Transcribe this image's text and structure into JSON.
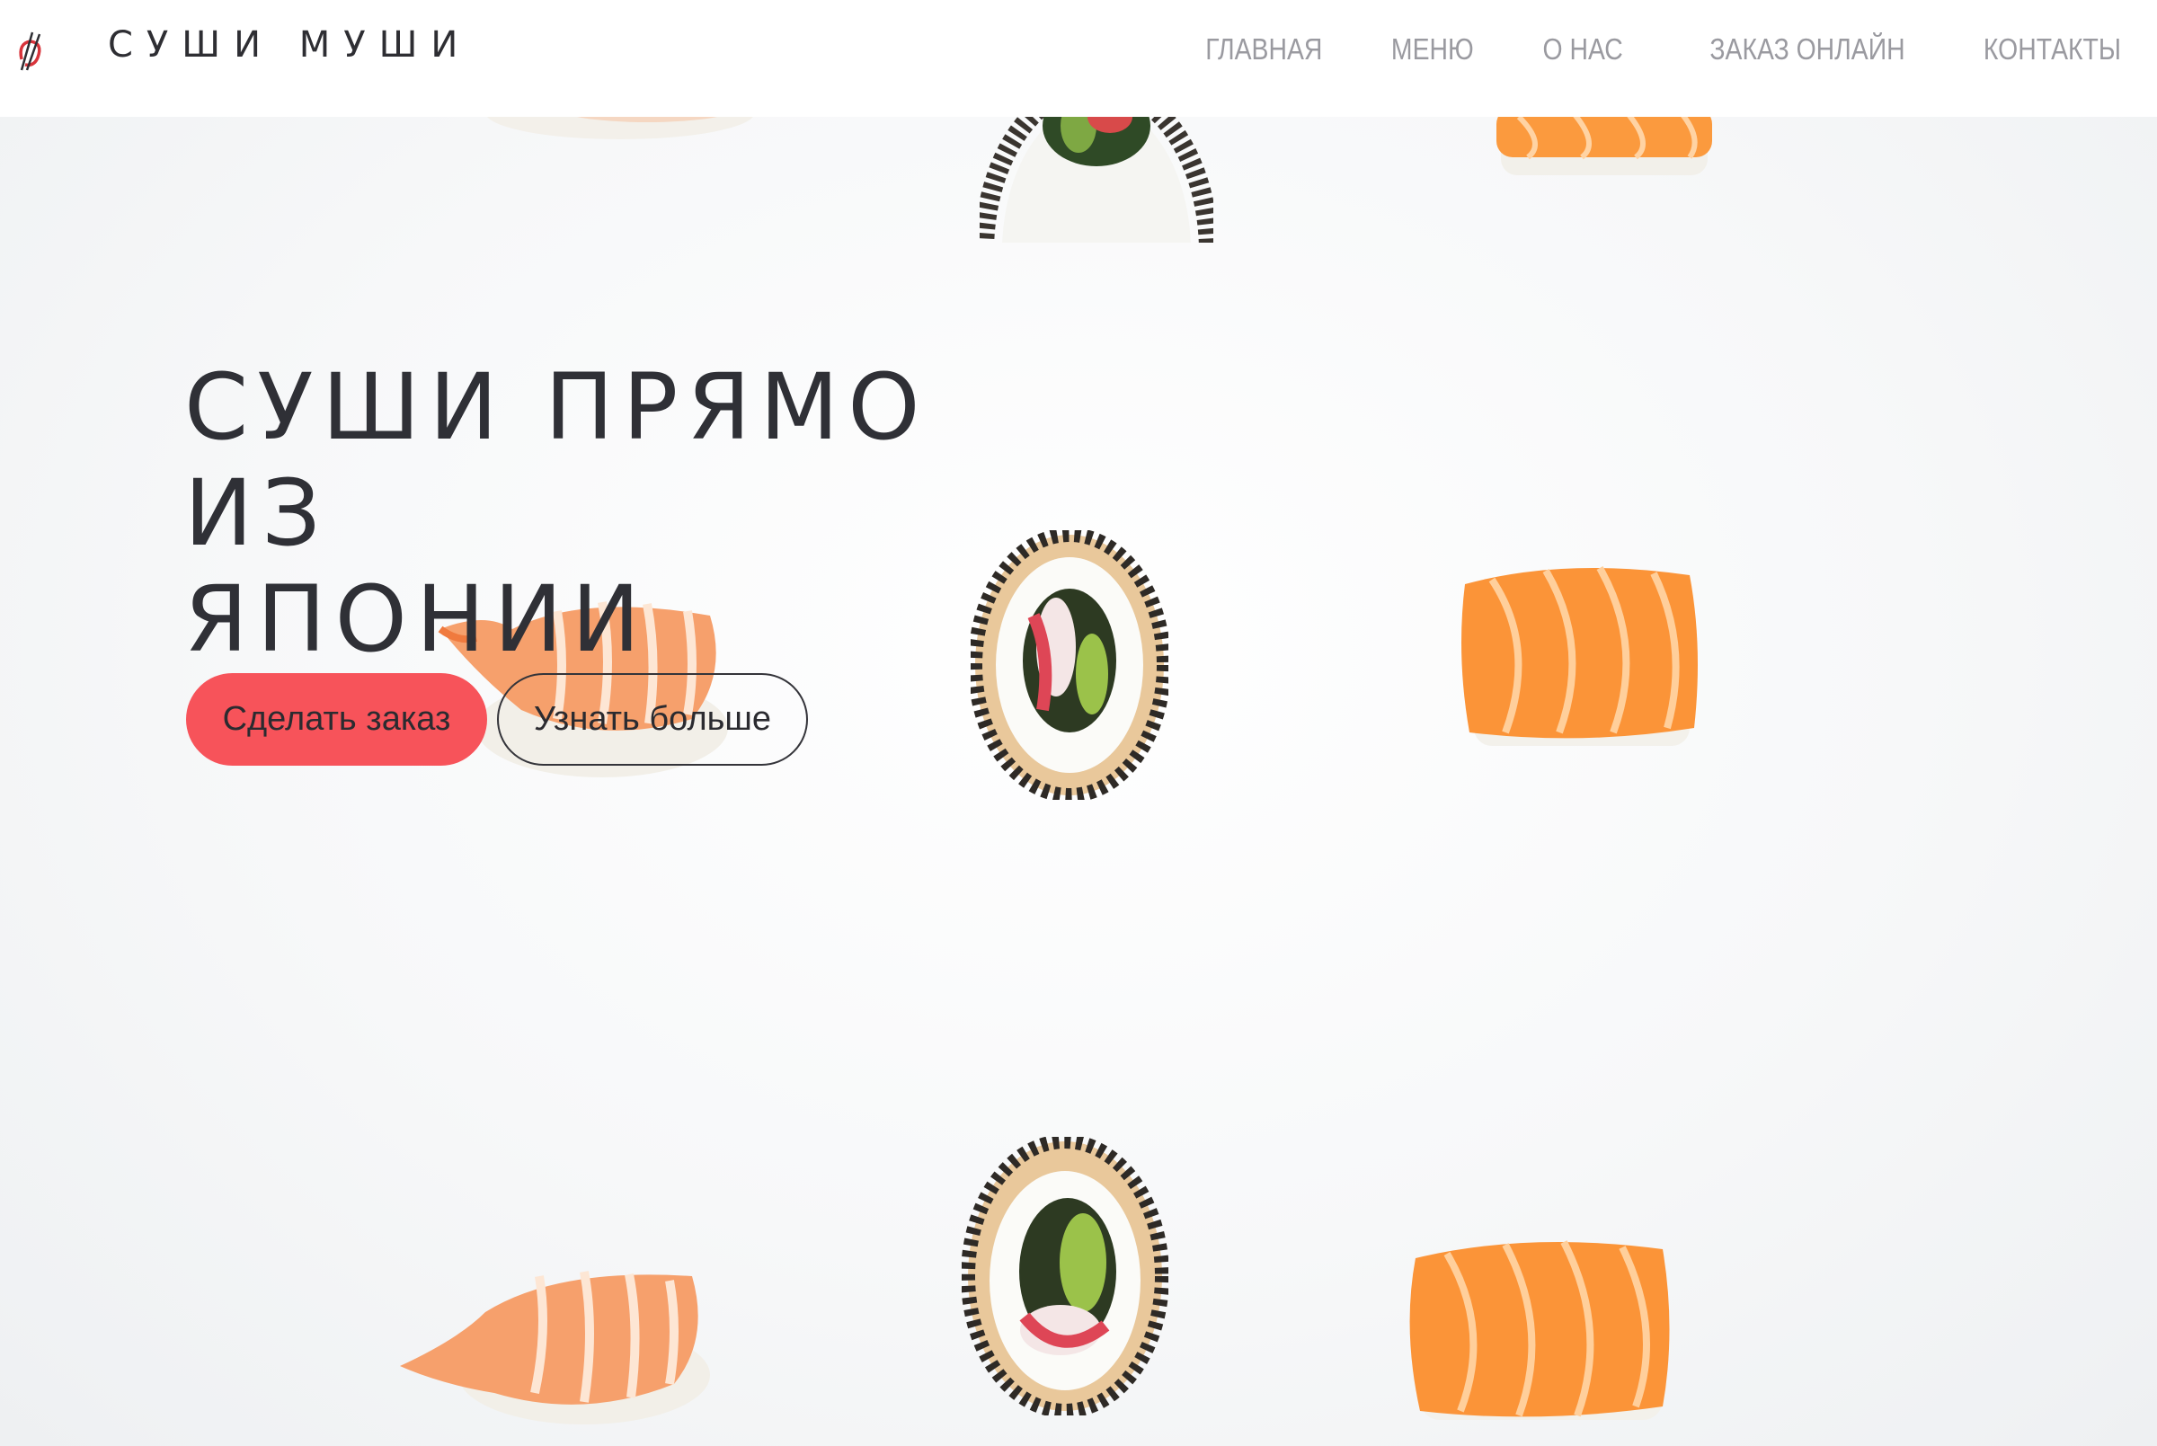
{
  "brand": {
    "name": "СУШИ МУШИ",
    "logo_icon": "chopsticks-logo-icon"
  },
  "nav": {
    "items": [
      {
        "label": "ГЛАВНАЯ"
      },
      {
        "label": "МЕНЮ"
      },
      {
        "label": "О НАС"
      },
      {
        "label": "ЗАКАЗ ОНЛАЙН"
      },
      {
        "label": "КОНТАКТЫ"
      }
    ]
  },
  "hero": {
    "headline_line1": "СУШИ ПРЯМО ИЗ",
    "headline_line2": "ЯПОНИИ",
    "primary_button": "Сделать заказ",
    "secondary_button": "Узнать больше"
  },
  "colors": {
    "accent": "#f7535a",
    "text_dark": "#2f3036",
    "nav_text": "#9a9aa0",
    "background": "#f6f7f8"
  }
}
